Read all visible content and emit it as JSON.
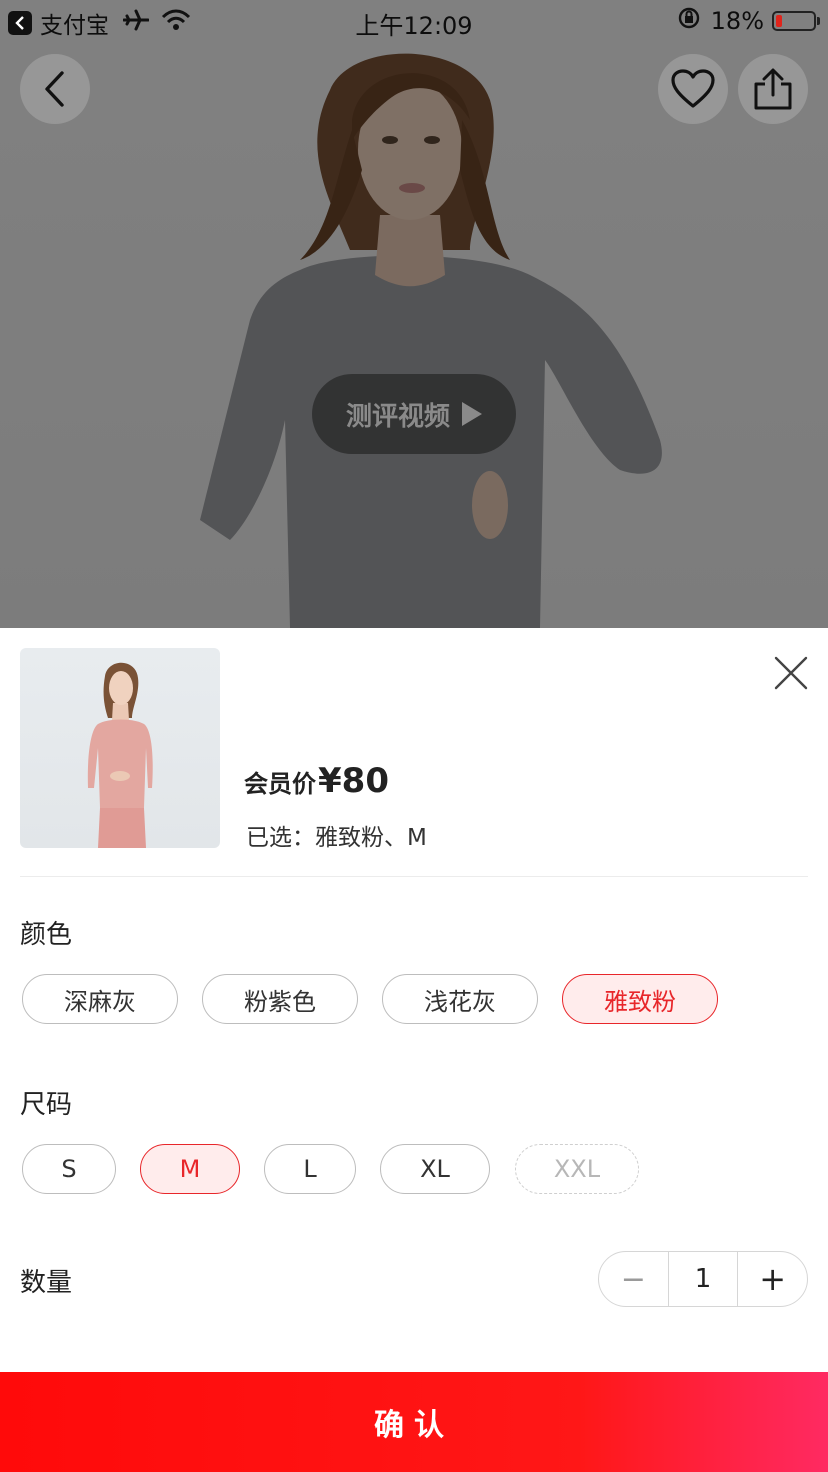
{
  "status_bar": {
    "app_name": "支付宝",
    "time": "上午12:09",
    "battery": "18%",
    "battery_level": 0.18,
    "icons": [
      "back-to-app-icon",
      "airplane-icon",
      "wifi-icon",
      "rotation-lock-icon",
      "battery-icon"
    ]
  },
  "hero": {
    "video_button_label": "测评视频",
    "icons": [
      "back-arrow-icon",
      "heart-icon",
      "share-icon",
      "play-icon"
    ]
  },
  "sheet": {
    "price_label": "会员价",
    "price_value": "¥80",
    "selected_text": "已选：雅致粉、M",
    "color_title": "颜色",
    "colors": [
      {
        "label": "深麻灰",
        "state": "normal"
      },
      {
        "label": "粉紫色",
        "state": "normal"
      },
      {
        "label": "浅花灰",
        "state": "normal"
      },
      {
        "label": "雅致粉",
        "state": "selected"
      }
    ],
    "size_title": "尺码",
    "sizes": [
      {
        "label": "S",
        "state": "normal"
      },
      {
        "label": "M",
        "state": "selected"
      },
      {
        "label": "L",
        "state": "normal"
      },
      {
        "label": "XL",
        "state": "normal"
      },
      {
        "label": "XXL",
        "state": "disabled"
      }
    ],
    "quantity_title": "数量",
    "quantity": "1",
    "minus_symbol": "−",
    "plus_symbol": "+",
    "confirm_label": "确认",
    "icons": [
      "close-icon"
    ]
  },
  "colors": {
    "accent": "#e8262a",
    "confirm_gradient_start": "#ff0a0a",
    "confirm_gradient_end": "#ff2a62",
    "selected_bg": "#ffecec"
  }
}
